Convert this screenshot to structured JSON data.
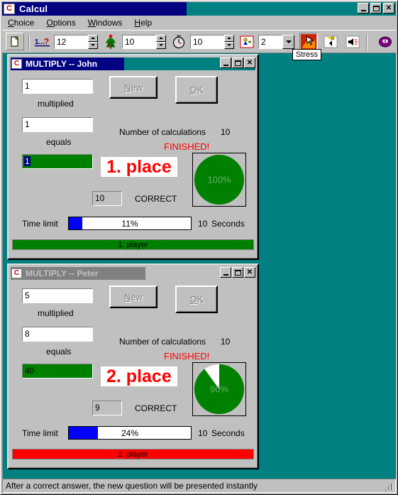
{
  "window": {
    "title": "Calcul",
    "icon": "calcul-app-icon",
    "controls": {
      "minimize": "_",
      "maximize": "□",
      "close": "✕"
    }
  },
  "menu": {
    "items": [
      {
        "label": "Choice",
        "accel": "C"
      },
      {
        "label": "Options",
        "accel": "O"
      },
      {
        "label": "Windows",
        "accel": "W"
      },
      {
        "label": "Help",
        "accel": "H"
      }
    ]
  },
  "toolbar": {
    "new_document_icon": "new-document-icon",
    "questions_icon": "question-number-icon",
    "questions_value": "12",
    "difficulty_icon": "traffic-light-icon",
    "difficulty_value": "10",
    "timer_icon": "stopwatch-icon",
    "timer_value": "10",
    "players_icon": "players-icon",
    "players_value": "2",
    "stress_icon": "stress-icon",
    "sound_icon": "sound-icon",
    "speaker_icon": "speaker-mute-icon",
    "help_icon": "help-book-icon",
    "tooltip": "Stress"
  },
  "players": [
    {
      "title": "MULTIPLY  --  John",
      "active": true,
      "operand1": "1",
      "label_multiplied": "multiplied",
      "operand2": "1",
      "label_equals": "equals",
      "answer": "1",
      "answer_selected": true,
      "new_button": "New",
      "new_accel": "N",
      "ok_button": "OK",
      "ok_accel": "O",
      "calc_label": "Number of calculations",
      "calc_count": "10",
      "finished": "FINISHED!",
      "place": "1. place",
      "correct_count": "10",
      "correct_label": "CORRECT",
      "pie_percent": 100,
      "pie_label": "100%",
      "timelimit_label": "Time limit",
      "timelimit_percent": 11,
      "timelimit_text": "11%",
      "seconds_value": "10",
      "seconds_label": "Seconds",
      "status_text": "1. player",
      "status_color": "#008000"
    },
    {
      "title": "MULTIPLY  --  Peter",
      "active": false,
      "operand1": "5",
      "label_multiplied": "multiplied",
      "operand2": "8",
      "label_equals": "equals",
      "answer": "40",
      "answer_selected": false,
      "new_button": "New",
      "new_accel": "N",
      "ok_button": "OK",
      "ok_accel": "O",
      "calc_label": "Number of calculations",
      "calc_count": "10",
      "finished": "FINISHED!",
      "place": "2. place",
      "correct_count": "9",
      "correct_label": "CORRECT",
      "pie_percent": 90,
      "pie_label": "90%",
      "timelimit_label": "Time limit",
      "timelimit_percent": 24,
      "timelimit_text": "24%",
      "seconds_value": "10",
      "seconds_label": "Seconds",
      "status_text": "2. player",
      "status_color": "#ff0000"
    }
  ],
  "statusbar": {
    "text": "After a correct answer, the new question will be presented instantly"
  },
  "colors": {
    "face": "#c0c0c0",
    "mdi_background": "#008080",
    "title_active": "#000080",
    "title_inactive": "#808080",
    "green": "#008000",
    "red": "#ff0000",
    "blue": "#0000ff"
  }
}
